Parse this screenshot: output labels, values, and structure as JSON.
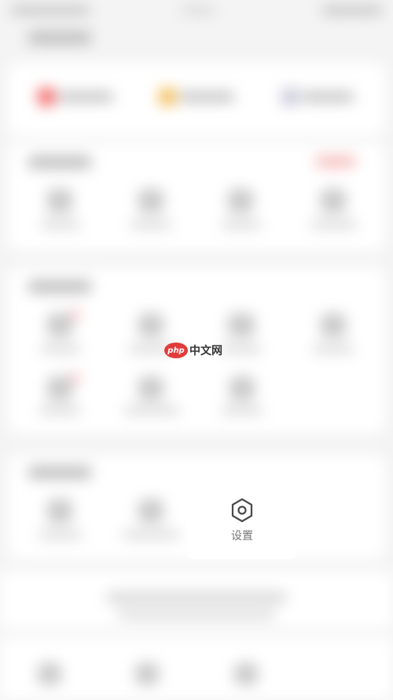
{
  "watermark": {
    "logo_text": "php",
    "site_name": "中文网"
  },
  "settings": {
    "label": "设置",
    "icon": "hexagon-gear-icon"
  }
}
